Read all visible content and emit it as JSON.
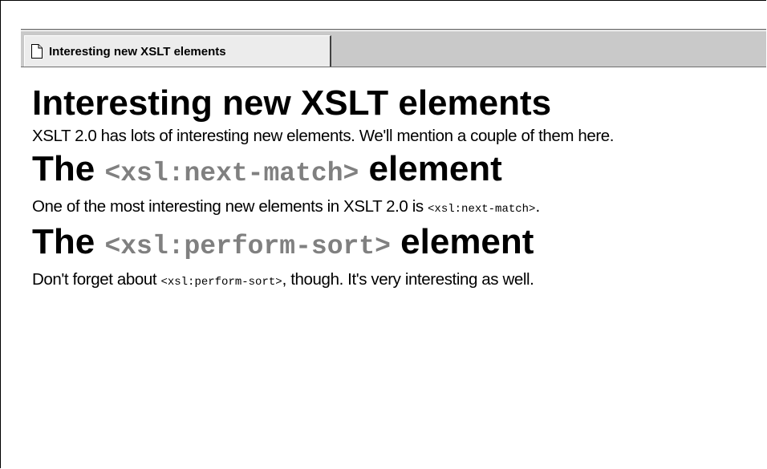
{
  "tab": {
    "title": "Interesting new XSLT elements",
    "icon": "document-icon"
  },
  "document": {
    "title": "Interesting new XSLT elements",
    "intro": "XSLT 2.0 has lots of interesting new elements. We'll mention a couple of them here.",
    "sections": [
      {
        "heading_prefix": "The ",
        "heading_code": "<xsl:next-match>",
        "heading_suffix": " element",
        "para_prefix": "One of the most interesting new elements in XSLT 2.0 is ",
        "para_code": "<xsl:next-match>",
        "para_suffix": "."
      },
      {
        "heading_prefix": "The ",
        "heading_code": "<xsl:perform-sort>",
        "heading_suffix": " element",
        "para_prefix": "Don't forget about ",
        "para_code": "<xsl:perform-sort>",
        "para_suffix": ", though. It's very interesting as well."
      }
    ]
  },
  "colors": {
    "tab_strip": "#c9c9c9",
    "tab": "#ececec",
    "code_heading": "#808080",
    "text": "#000000"
  }
}
